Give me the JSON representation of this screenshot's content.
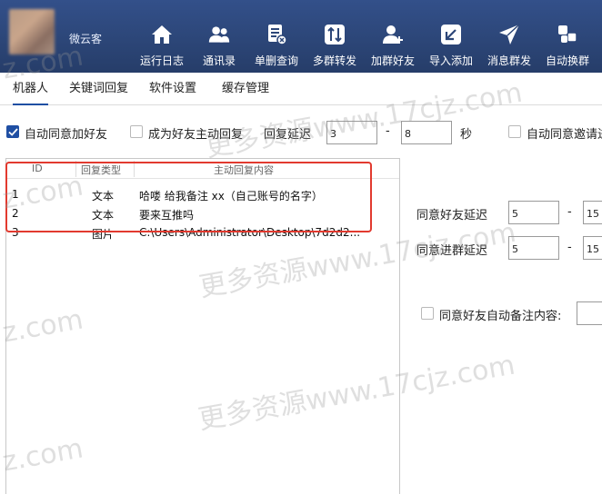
{
  "app": {
    "name": "微云客"
  },
  "toolbar": [
    {
      "label": "运行日志",
      "icon": "home-icon"
    },
    {
      "label": "通讯录",
      "icon": "contacts-icon"
    },
    {
      "label": "单删查询",
      "icon": "delete-check-icon"
    },
    {
      "label": "多群转发",
      "icon": "forward-icon"
    },
    {
      "label": "加群好友",
      "icon": "add-friend-icon"
    },
    {
      "label": "导入添加",
      "icon": "import-icon"
    },
    {
      "label": "消息群发",
      "icon": "send-icon"
    },
    {
      "label": "自动换群",
      "icon": "switch-group-icon"
    }
  ],
  "tabs": [
    {
      "label": "机器人",
      "active": true
    },
    {
      "label": "关键词回复",
      "active": false
    },
    {
      "label": "软件设置",
      "active": false
    },
    {
      "label": "缓存管理",
      "active": false
    }
  ],
  "options": {
    "auto_accept_friend": {
      "label": "自动同意加好友",
      "checked": true
    },
    "become_friend_auto_reply": {
      "label": "成为好友主动回复",
      "checked": false
    },
    "reply_delay_label": "回复延迟",
    "reply_delay_min": "3",
    "reply_delay_dash": "-",
    "reply_delay_max": "8",
    "reply_delay_unit": "秒",
    "auto_accept_invite": {
      "label": "自动同意邀请进",
      "checked": false
    }
  },
  "table": {
    "headers": [
      "ID",
      "回复类型",
      "主动回复内容"
    ],
    "rows": [
      {
        "id": "1",
        "type": "文本",
        "content": "哈喽 给我备注 xx（自己账号的名字）"
      },
      {
        "id": "2",
        "type": "文本",
        "content": "要来互推吗"
      },
      {
        "id": "3",
        "type": "图片",
        "content": "C:\\Users\\Administrator\\Desktop\\7d2d2..."
      }
    ]
  },
  "right_panel": {
    "friend_delay_label": "同意好友延迟",
    "friend_delay_min": "5",
    "friend_delay_dash": "-",
    "friend_delay_max": "15",
    "group_delay_label": "同意进群延迟",
    "group_delay_min": "5",
    "group_delay_dash": "-",
    "group_delay_max": "15",
    "auto_remark": {
      "label": "同意好友自动备注内容:",
      "checked": false
    }
  },
  "watermarks": [
    {
      "text": "更多资源www.17cjz.com"
    },
    {
      "text": "z.com"
    }
  ],
  "colors": {
    "header": "#2c4678",
    "accent": "#1f4fa3",
    "highlight_border": "#e23a2f"
  }
}
